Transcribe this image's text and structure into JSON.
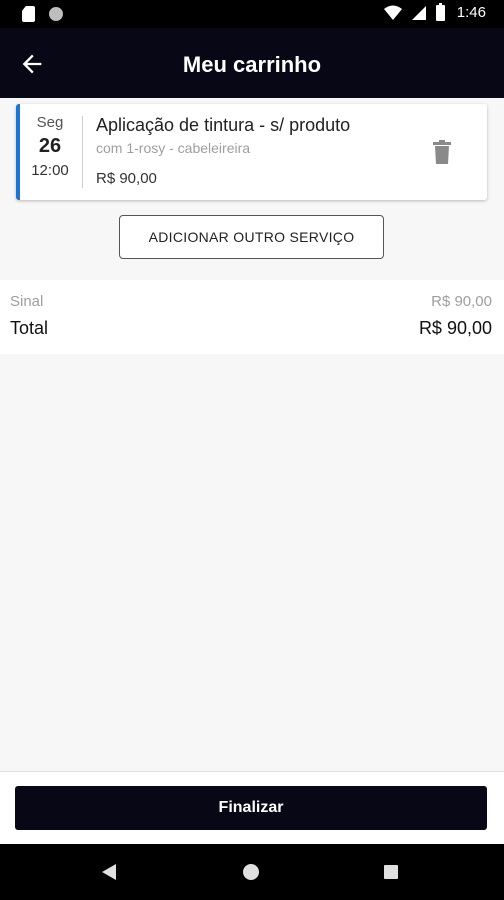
{
  "status_bar": {
    "time": "1:46",
    "icons": [
      "sd-card-icon",
      "circle-icon",
      "wifi-icon",
      "signal-icon",
      "battery-icon"
    ]
  },
  "app_bar": {
    "title": "Meu carrinho",
    "back_icon": "arrow-left-icon"
  },
  "cart_item": {
    "weekday": "Seg",
    "day": "26",
    "time": "12:00",
    "service": "Aplicação de tintura - s/ produto",
    "professional": "com 1-rosy - cabeleireira",
    "price": "R$ 90,00",
    "delete_icon": "trash-icon",
    "accent_color": "#1976d2"
  },
  "add_service_label": "ADICIONAR OUTRO SERVIÇO",
  "summary": {
    "sinal_label": "Sinal",
    "sinal_value": "R$ 90,00",
    "total_label": "Total",
    "total_value": "R$ 90,00"
  },
  "finalize_label": "Finalizar",
  "colors": {
    "primary_dark": "#070716"
  },
  "nav_bar": {
    "icons": [
      "nav-back-icon",
      "nav-home-icon",
      "nav-recents-icon"
    ]
  }
}
